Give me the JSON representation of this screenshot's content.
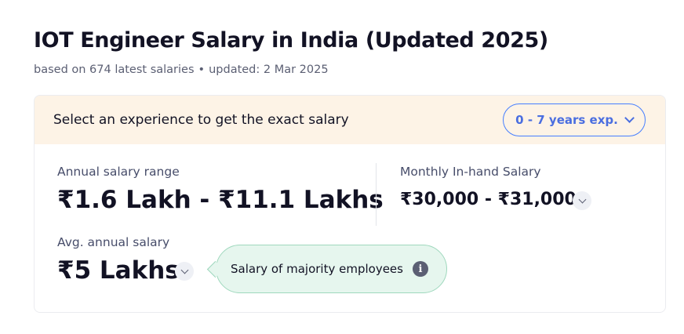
{
  "header": {
    "title": "IOT Engineer Salary in India (Updated 2025)",
    "subtitle_count": "based on 674 latest salaries",
    "subtitle_sep": "•",
    "subtitle_updated": "updated: 2 Mar 2025"
  },
  "card": {
    "head_text": "Select an experience to get the exact salary",
    "experience_select": {
      "selected": "0 - 7 years exp.",
      "icon": "chevron-down-icon"
    },
    "annual": {
      "label": "Annual salary range",
      "value": "₹1.6 Lakh - ₹11.1 Lakhs"
    },
    "monthly": {
      "label": "Monthly In-hand Salary",
      "value": "₹30,000 - ₹31,000"
    },
    "average": {
      "label": "Avg. annual salary",
      "value": "₹5 Lakhs"
    },
    "tooltip": {
      "text": "Salary of majority employees",
      "icon": "i"
    }
  },
  "colors": {
    "accent": "#4a6ee0",
    "header_bg": "#fdf3e6",
    "tooltip_bg": "#e6f6ee",
    "tooltip_border": "#9fd8bd"
  }
}
